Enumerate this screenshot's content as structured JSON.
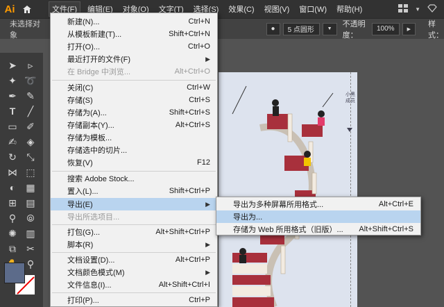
{
  "app": {
    "logo": "Ai"
  },
  "menubar": {
    "items": [
      "文件(F)",
      "编辑(E)",
      "对象(O)",
      "文字(T)",
      "选择(S)",
      "效果(C)",
      "视图(V)",
      "窗口(W)",
      "帮助(H)"
    ]
  },
  "options_bar": {
    "selection": "未选择对象",
    "brush_size": "5 点圆形",
    "opacity_label": "不透明度：",
    "opacity_value": "100%",
    "style_label": "样式："
  },
  "file_menu": {
    "items": [
      {
        "label": "新建(N)...",
        "shortcut": "Ctrl+N"
      },
      {
        "label": "从模板新建(T)...",
        "shortcut": "Shift+Ctrl+N"
      },
      {
        "label": "打开(O)...",
        "shortcut": "Ctrl+O"
      },
      {
        "label": "最近打开的文件(F)",
        "shortcut": ""
      },
      {
        "label": "在 Bridge 中浏览...",
        "shortcut": "Alt+Ctrl+O"
      },
      {
        "label": "关闭(C)",
        "shortcut": "Ctrl+W"
      },
      {
        "label": "存储(S)",
        "shortcut": "Ctrl+S"
      },
      {
        "label": "存储为(A)...",
        "shortcut": "Shift+Ctrl+S"
      },
      {
        "label": "存储副本(Y)...",
        "shortcut": "Alt+Ctrl+S"
      },
      {
        "label": "存储为模板...",
        "shortcut": ""
      },
      {
        "label": "存储选中的切片...",
        "shortcut": ""
      },
      {
        "label": "恢复(V)",
        "shortcut": "F12"
      },
      {
        "label": "搜索 Adobe Stock...",
        "shortcut": ""
      },
      {
        "label": "置入(L)...",
        "shortcut": "Shift+Ctrl+P"
      },
      {
        "label": "导出(E)",
        "shortcut": ""
      },
      {
        "label": "导出所选项目...",
        "shortcut": ""
      },
      {
        "label": "打包(G)...",
        "shortcut": "Alt+Shift+Ctrl+P"
      },
      {
        "label": "脚本(R)",
        "shortcut": ""
      },
      {
        "label": "文档设置(D)...",
        "shortcut": "Alt+Ctrl+P"
      },
      {
        "label": "文档颜色模式(M)",
        "shortcut": ""
      },
      {
        "label": "文件信息(I)...",
        "shortcut": "Alt+Shift+Ctrl+I"
      },
      {
        "label": "打印(P)...",
        "shortcut": "Ctrl+P"
      }
    ]
  },
  "export_submenu": {
    "items": [
      {
        "label": "导出为多种屏幕所用格式...",
        "shortcut": "Alt+Ctrl+E"
      },
      {
        "label": "导出为...",
        "shortcut": ""
      },
      {
        "label": "存储为 Web 所用格式（旧版）...",
        "shortcut": "Alt+Shift+Ctrl+S"
      }
    ]
  },
  "artboard": {
    "vertical_label": "小黑成员"
  },
  "colors": {
    "accent_highlight": "#b9d4ef",
    "logo": "#ff9a00",
    "fill_swatch": "#5c6b8a"
  }
}
